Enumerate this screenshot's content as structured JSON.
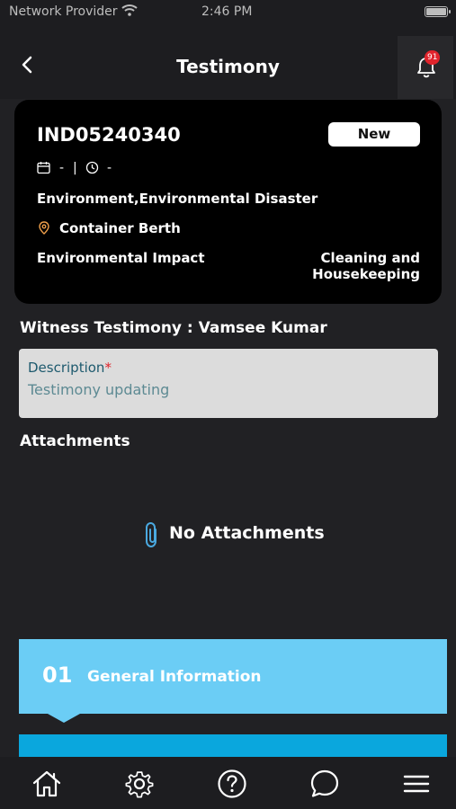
{
  "status_bar": {
    "carrier": "Network Provider",
    "time": "2:46 PM"
  },
  "header": {
    "title": "Testimony",
    "notification_count": "91"
  },
  "incident": {
    "id": "IND05240340",
    "status": "New",
    "date": "-",
    "separator": "|",
    "time": "-",
    "category": "Environment,Environmental Disaster",
    "location": "Container Berth",
    "impact": "Environmental Impact",
    "area": "Cleaning and Housekeeping"
  },
  "witness": {
    "title": "Witness Testimony : Vamsee Kumar"
  },
  "description": {
    "label": "Description",
    "required_mark": "*",
    "value": "Testimony updating"
  },
  "attachments": {
    "title": "Attachments",
    "empty_text": "No Attachments"
  },
  "sections": [
    {
      "number": "01",
      "label": "General Information"
    }
  ],
  "tab_bar": {
    "items": [
      "home-icon",
      "gear-icon",
      "help-icon",
      "chat-icon",
      "menu-icon"
    ]
  },
  "colors": {
    "background": "#212124",
    "card": "#000000",
    "accent_light": "#6bcdf5",
    "accent_dark": "#0aa7dd",
    "badge": "#e0242c",
    "location_pin": "#f0a04b"
  }
}
